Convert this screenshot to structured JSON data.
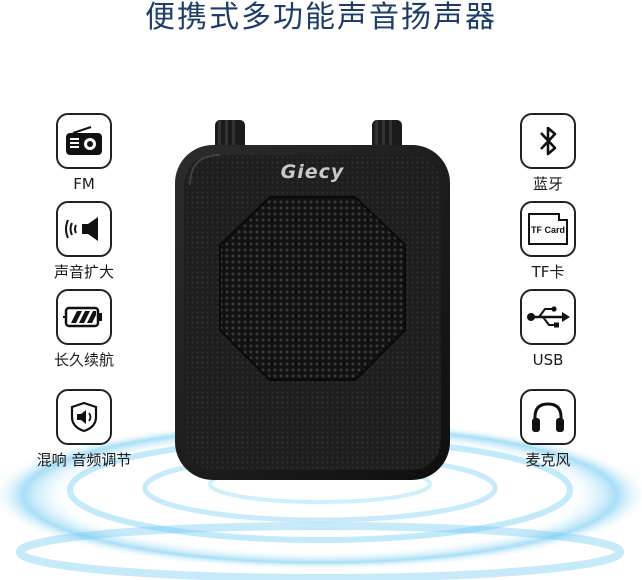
{
  "title": "便携式多功能声音扬声器",
  "brand": "Giecy",
  "features_left": [
    {
      "label": "FM",
      "icon": "radio-icon"
    },
    {
      "label": "声音扩大",
      "icon": "sound-amplify-icon"
    },
    {
      "label": "长久续航",
      "icon": "battery-icon"
    },
    {
      "label": "混响 音频调节",
      "icon": "echo-adjust-icon"
    }
  ],
  "features_right": [
    {
      "label": "蓝牙",
      "icon": "bluetooth-icon"
    },
    {
      "label": "TF卡",
      "icon": "tf-card-icon",
      "icon_text": "TF Card"
    },
    {
      "label": "USB",
      "icon": "usb-icon"
    },
    {
      "label": "麦克风",
      "icon": "headphones-icon"
    }
  ],
  "colors": {
    "title": "#1d3d6a",
    "glow": "#5fc3f0",
    "speaker": "#1b1b1b"
  }
}
